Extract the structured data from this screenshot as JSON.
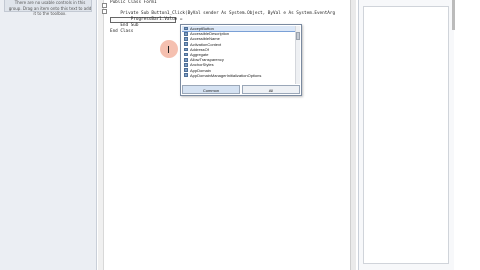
{
  "toolbox": {
    "message": "There are no usable controls in this group. Drag an item onto this text to add it to the toolbox."
  },
  "code": {
    "lines": [
      {
        "text": "Public Class Form1"
      },
      {
        "text": "    Private Sub Button1_Click(ByVal sender As System.Object, ByVal e As System.EventArg"
      },
      {
        "text": "        ProgressBar1.Value = "
      },
      {
        "text": "    End Sub"
      },
      {
        "text": "End Class"
      }
    ]
  },
  "intellisense": {
    "items": [
      "AcceptButton",
      "AccessibleDescription",
      "AccessibleName",
      "ActivationContext",
      "AddressOf",
      "Aggregate",
      "AllowTransparency",
      "AnchorStyles",
      "AppDomain",
      "AppDomainManagerInitializationOptions"
    ],
    "selected_index": 0,
    "tabs": {
      "common": "Common",
      "all": "All"
    }
  },
  "colors": {
    "keyword": "#1a33c8",
    "toolbox_bg": "#ebeef3",
    "cursor_highlight": "#f4b9a7",
    "selection": "#dbe7f7"
  }
}
